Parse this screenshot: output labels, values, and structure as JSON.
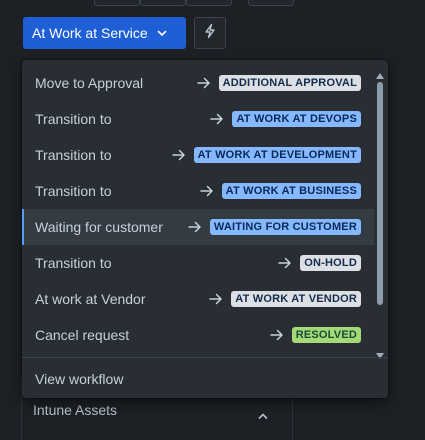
{
  "header": {
    "status_button_label": "At Work at Service",
    "status_button_icon": "chevron-down-icon",
    "automation_icon": "lightning-bolt-icon",
    "brand_color": "#1f5fd6"
  },
  "dropdown": {
    "items": [
      {
        "label": "Move to Approval",
        "target": "ADDITIONAL APPROVAL",
        "lozenge_color": "grey"
      },
      {
        "label": "Transition to",
        "target": "AT WORK AT DEVOPS",
        "lozenge_color": "blue"
      },
      {
        "label": "Transition to",
        "target": "AT WORK AT DEVELOPMENT",
        "lozenge_color": "blue"
      },
      {
        "label": "Transition to",
        "target": "AT WORK AT BUSINESS",
        "lozenge_color": "blue"
      },
      {
        "label": "Waiting for customer",
        "target": "WAITING FOR CUSTOMER",
        "lozenge_color": "blue",
        "selected": true
      },
      {
        "label": "Transition to",
        "target": "ON-HOLD",
        "lozenge_color": "grey"
      },
      {
        "label": "At work at Vendor",
        "target": "AT WORK AT VENDOR",
        "lozenge_color": "grey"
      },
      {
        "label": "Cancel request",
        "target": "RESOLVED",
        "lozenge_color": "green"
      }
    ],
    "footer_label": "View workflow",
    "arrow_icon": "arrow-right-icon",
    "scroll_up_icon": "scroll-up-arrow-icon",
    "scroll_down_icon": "scroll-down-arrow-icon",
    "colors": {
      "grey_lozenge": "#dcdfe4",
      "blue_lozenge": "#85b8ff",
      "green_lozenge": "#a3d977",
      "selected_accent": "#579dff"
    }
  },
  "background_panel": {
    "section_label": "Intune Assets",
    "section_icon": "chevron-up-icon"
  }
}
